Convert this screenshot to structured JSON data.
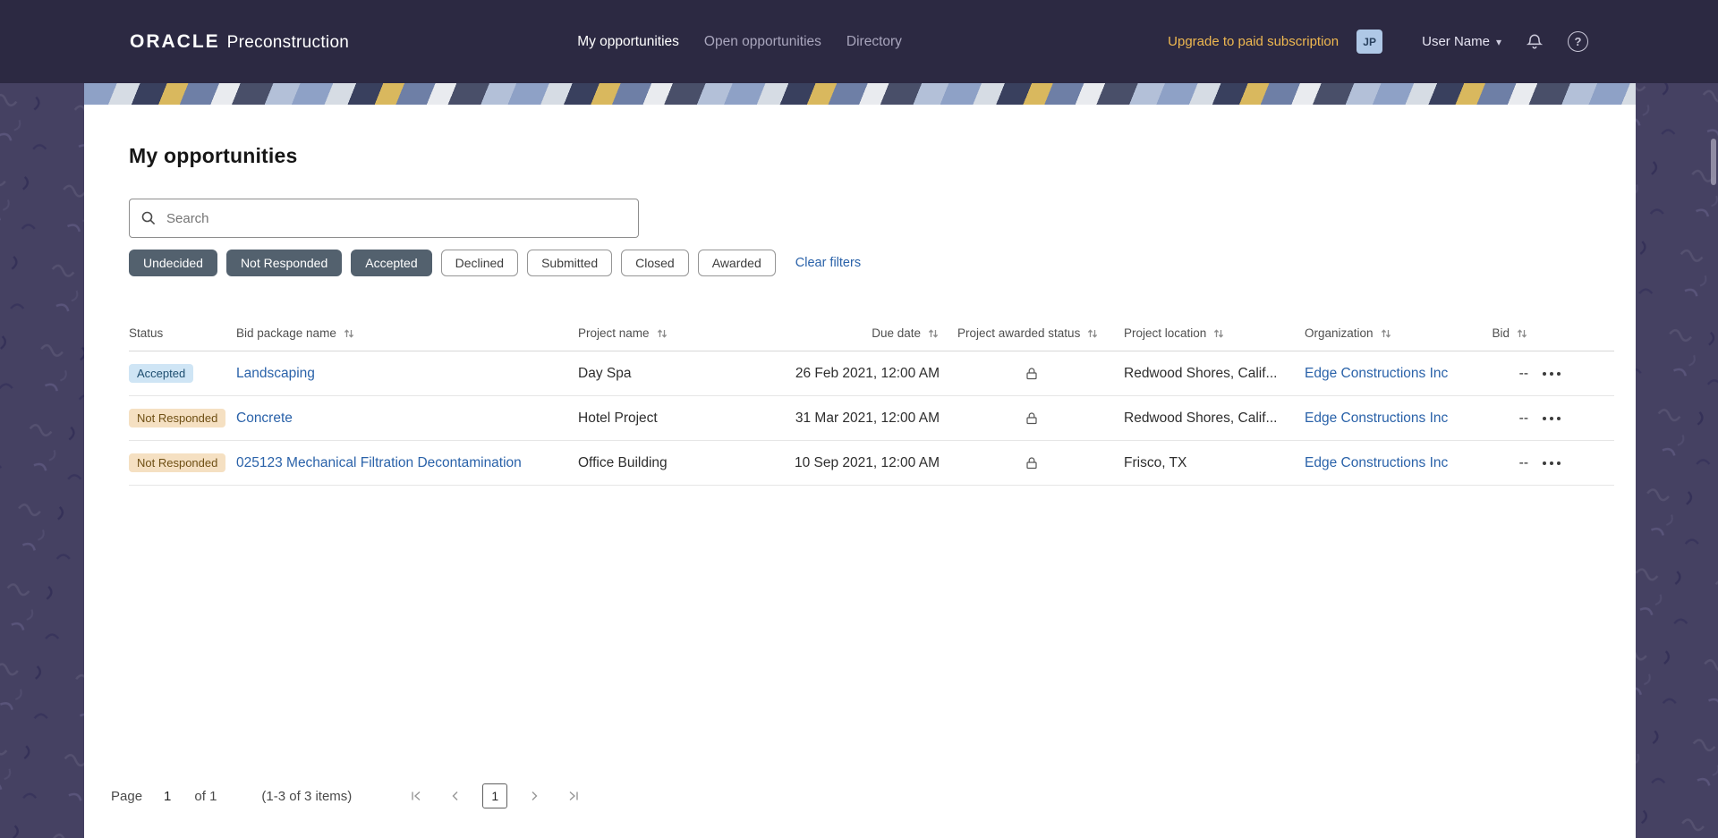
{
  "header": {
    "brand": {
      "name": "ORACLE",
      "product": "Preconstruction"
    },
    "nav": [
      {
        "label": "My opportunities"
      },
      {
        "label": "Open opportunities"
      },
      {
        "label": "Directory"
      }
    ],
    "upgrade_label": "Upgrade to paid subscription",
    "avatar_initials": "JP",
    "user_name": "User Name"
  },
  "icons": {
    "help_glyph": "?",
    "caret_down": "▾"
  },
  "page": {
    "title": "My opportunities",
    "search": {
      "placeholder": "Search"
    },
    "filters": {
      "chips": [
        {
          "label": "Undecided",
          "selected": true
        },
        {
          "label": "Not Responded",
          "selected": true
        },
        {
          "label": "Accepted",
          "selected": true
        },
        {
          "label": "Declined",
          "selected": false
        },
        {
          "label": "Submitted",
          "selected": false
        },
        {
          "label": "Closed",
          "selected": false
        },
        {
          "label": "Awarded",
          "selected": false
        }
      ],
      "clear_label": "Clear filters"
    },
    "table": {
      "columns": [
        {
          "label": "Status",
          "sortable": false
        },
        {
          "label": "Bid package name",
          "sortable": true
        },
        {
          "label": "Project name",
          "sortable": true
        },
        {
          "label": "Due date",
          "sortable": true
        },
        {
          "label": "Project awarded status",
          "sortable": true
        },
        {
          "label": "Project location",
          "sortable": true
        },
        {
          "label": "Organization",
          "sortable": true
        },
        {
          "label": "Bid",
          "sortable": true
        }
      ],
      "rows": [
        {
          "status": "Accepted",
          "bid_package": "Landscaping",
          "project": "Day Spa",
          "due": "26 Feb 2021, 12:00 AM",
          "location": "Redwood Shores, Calif...",
          "organization": "Edge Constructions Inc",
          "bid": "--"
        },
        {
          "status": "Not Responded",
          "bid_package": "Concrete",
          "project": "Hotel Project",
          "due": "31 Mar 2021, 12:00 AM",
          "location": "Redwood Shores, Calif...",
          "organization": "Edge Constructions Inc",
          "bid": "--"
        },
        {
          "status": "Not Responded",
          "bid_package": "025123 Mechanical Filtration Decontamination",
          "project": "Office Building",
          "due": "10 Sep 2021, 12:00 AM",
          "location": "Frisco, TX",
          "organization": "Edge Constructions Inc",
          "bid": "--"
        }
      ]
    },
    "pagination": {
      "page_label": "Page",
      "page_value": "1",
      "of_label": "of 1",
      "items_label": "(1-3 of 3 items)",
      "current_page": "1"
    }
  },
  "colors": {
    "header_bg": "#2c2942",
    "page_bg": "#454162",
    "accent_gold": "#efb850",
    "link_blue": "#2a62a9",
    "chip_selected": "#53616e",
    "badge_accepted_bg": "#cfe5f5",
    "badge_warn_bg": "#f5e0c2"
  }
}
